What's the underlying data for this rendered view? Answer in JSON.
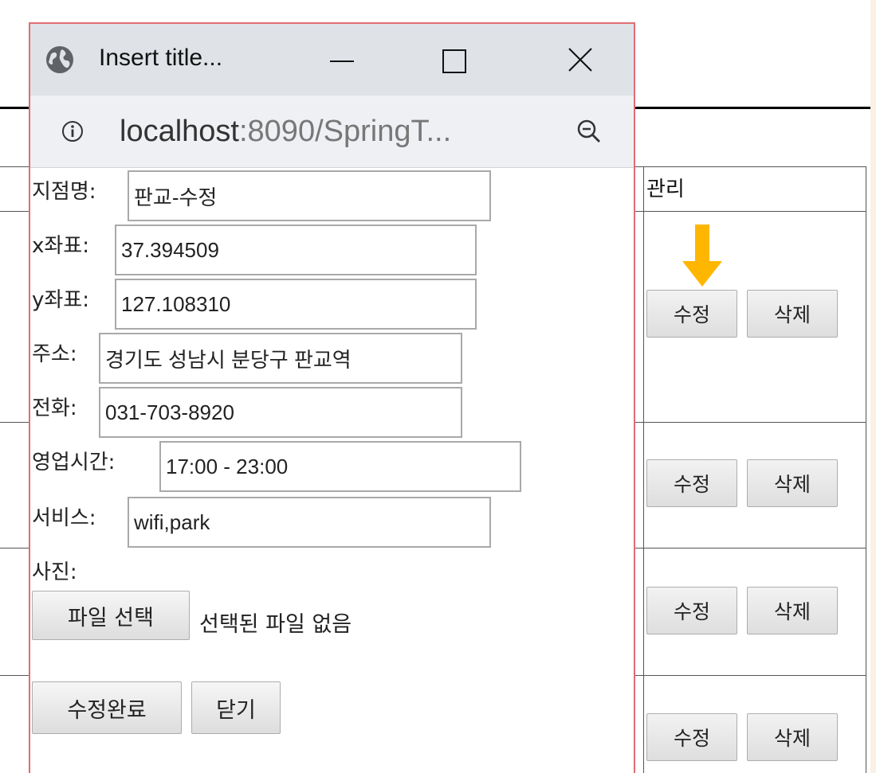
{
  "background": {
    "table_header_manage": "관리",
    "rows": [
      {
        "edit_label": "수정",
        "delete_label": "삭제"
      },
      {
        "edit_label": "수정",
        "delete_label": "삭제"
      },
      {
        "edit_label": "수정",
        "delete_label": "삭제"
      },
      {
        "edit_label": "수정",
        "delete_label": "삭제"
      }
    ],
    "arrow_color": "#ffb600"
  },
  "popup": {
    "title": "Insert title...",
    "address": {
      "host": "localhost",
      "rest": ":8090/SpringT..."
    },
    "window_controls": [
      "minimize-icon",
      "maximize-icon",
      "close-icon"
    ],
    "form": {
      "name": {
        "label": "지점명:",
        "value": "판교-수정"
      },
      "x": {
        "label": "x좌표:",
        "value": "37.394509"
      },
      "y": {
        "label": "y좌표:",
        "value": "127.108310"
      },
      "address": {
        "label": "주소:",
        "value": "경기도 성남시 분당구 판교역"
      },
      "phone": {
        "label": "전화:",
        "value": "031-703-8920"
      },
      "hours": {
        "label": "영업시간:",
        "value": "17:00 - 23:00"
      },
      "service": {
        "label": "서비스:",
        "value": "wifi,park"
      },
      "photo": {
        "label": "사진:",
        "choose_label": "파일 선택",
        "status": "선택된 파일 없음"
      }
    },
    "buttons": {
      "submit": "수정완료",
      "close": "닫기"
    }
  }
}
